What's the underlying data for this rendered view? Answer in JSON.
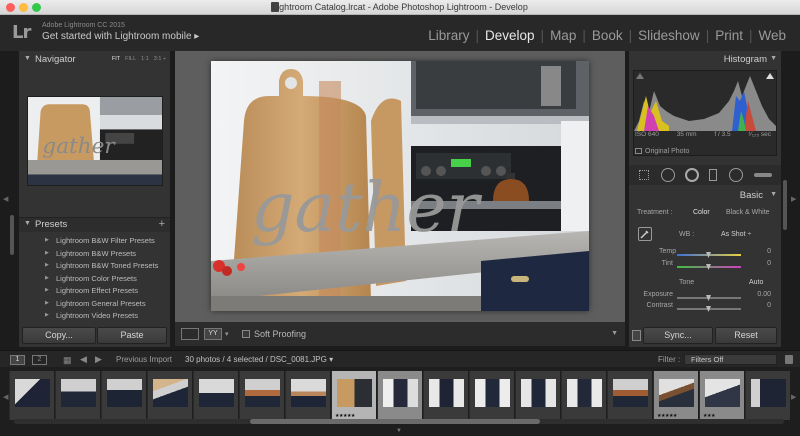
{
  "window": {
    "title": "Lightroom Catalog.lrcat - Adobe Photoshop Lightroom - Develop"
  },
  "identity": {
    "logo": "Lr",
    "version": "Adobe Lightroom CC 2015",
    "get_started": "Get started with Lightroom mobile ▸"
  },
  "modules": [
    {
      "label": "Library",
      "active": false
    },
    {
      "label": "Develop",
      "active": true
    },
    {
      "label": "Map",
      "active": false
    },
    {
      "label": "Book",
      "active": false
    },
    {
      "label": "Slideshow",
      "active": false
    },
    {
      "label": "Print",
      "active": false
    },
    {
      "label": "Web",
      "active": false
    }
  ],
  "navigator": {
    "title": "Navigator",
    "zoom": {
      "fit": "FIT",
      "fill": "FILL",
      "one": "1:1",
      "three": "3:1 ÷"
    }
  },
  "presets": {
    "title": "Presets",
    "add": "+",
    "items": [
      "Lightroom B&W Filter Presets",
      "Lightroom B&W Presets",
      "Lightroom B&W Toned Presets",
      "Lightroom Color Presets",
      "Lightroom Effect Presets",
      "Lightroom General Presets",
      "Lightroom Video Presets"
    ]
  },
  "left_buttons": {
    "copy": "Copy...",
    "paste": "Paste"
  },
  "toolbar": {
    "yy": "YY",
    "soft_proofing": "Soft Proofing"
  },
  "histogram": {
    "title": "Histogram",
    "iso": "ISO 640",
    "focal": "35 mm",
    "aperture": "f / 3.5",
    "shutter": "¹⁄₁₂₅ sec",
    "original_photo": "Original Photo"
  },
  "basic": {
    "title": "Basic",
    "treatment_label": "Treatment :",
    "color": "Color",
    "bw": "Black & White",
    "wb_label": "WB :",
    "wb_value": "As Shot ÷",
    "temp_label": "Temp",
    "temp_value": "0",
    "tint_label": "Tint",
    "tint_value": "0",
    "tone_label": "Tone",
    "auto": "Auto",
    "exposure_label": "Exposure",
    "exposure_value": "0.00",
    "contrast_label": "Contrast",
    "contrast_value": "0"
  },
  "right_buttons": {
    "sync": "Sync...",
    "reset": "Reset"
  },
  "filmstrip_bar": {
    "screen1": "1",
    "screen2": "2",
    "source": "Previous Import",
    "count": "30 photos / 4 selected / DSC_0081.JPG ▾",
    "filter_label": "Filter :",
    "filter_value": "Filters Off"
  },
  "filmstrip": {
    "ratings": [
      "",
      "",
      "",
      "",
      "",
      "",
      "",
      "★★★★★",
      "",
      "",
      "",
      "",
      "",
      "",
      "★★★★★",
      "★★★",
      ""
    ]
  },
  "colors": {
    "panel": "#333333",
    "center": "#5e5e5e",
    "accent_text": "#e8e8e8"
  }
}
